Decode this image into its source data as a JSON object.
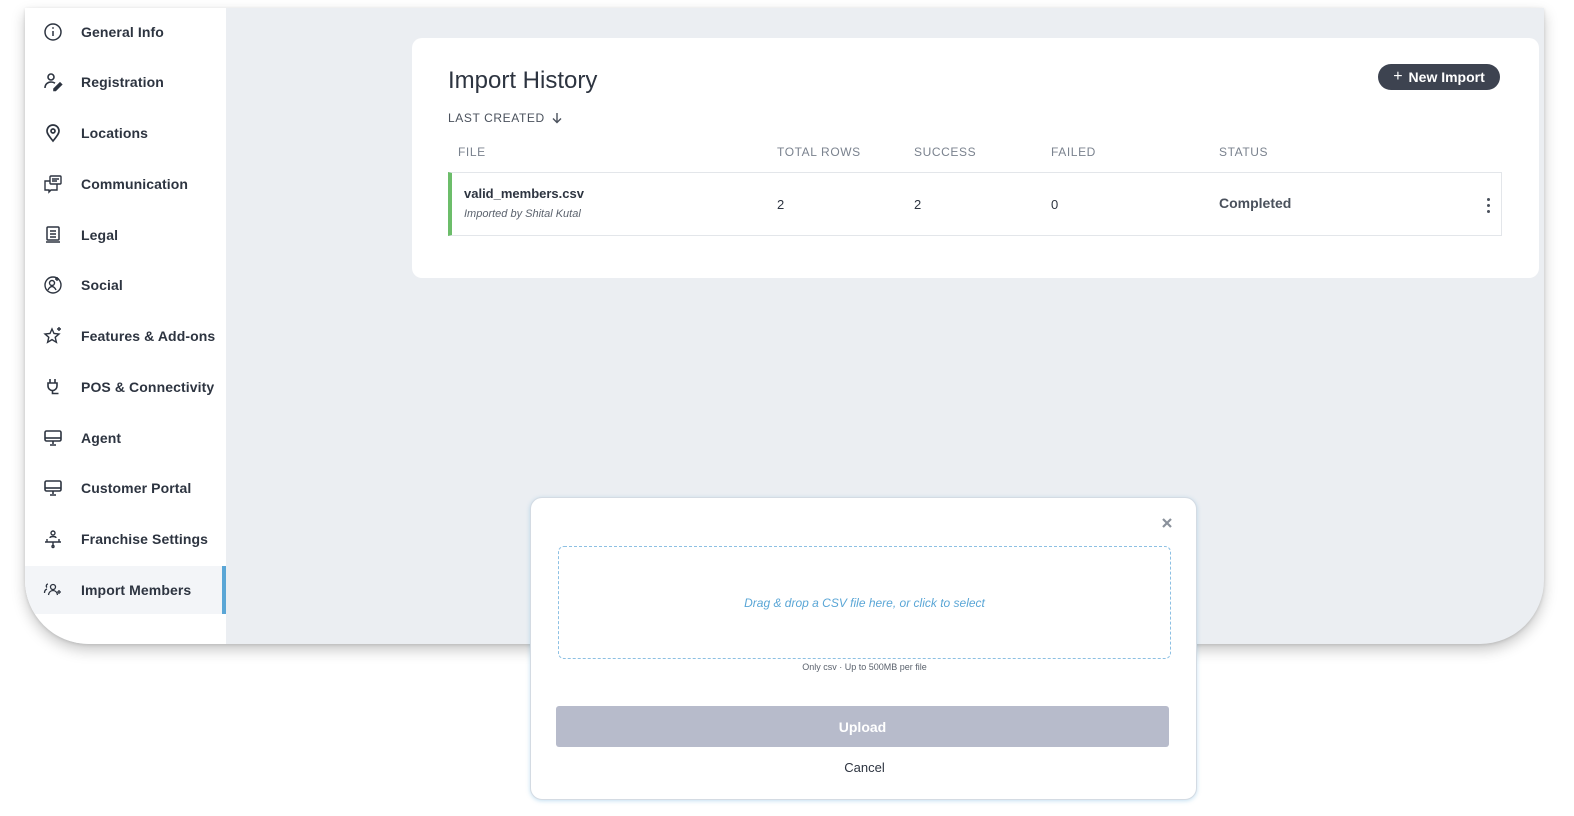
{
  "sidebar": {
    "items": [
      {
        "label": "General Info",
        "icon": "info-icon"
      },
      {
        "label": "Registration",
        "icon": "user-edit-icon"
      },
      {
        "label": "Locations",
        "icon": "location-pin-icon"
      },
      {
        "label": "Communication",
        "icon": "chat-window-icon"
      },
      {
        "label": "Legal",
        "icon": "document-icon"
      },
      {
        "label": "Social",
        "icon": "social-user-icon"
      },
      {
        "label": "Features & Add-ons",
        "icon": "star-plus-icon"
      },
      {
        "label": "POS & Connectivity",
        "icon": "plug-icon"
      },
      {
        "label": "Agent",
        "icon": "monitor-icon"
      },
      {
        "label": "Customer Portal",
        "icon": "monitor-icon"
      },
      {
        "label": "Franchise Settings",
        "icon": "franchise-icon"
      },
      {
        "label": "Import Members",
        "icon": "users-add-icon",
        "active": true
      }
    ]
  },
  "import_history": {
    "title": "Import History",
    "new_import_label": "New Import",
    "sort_label": "LAST CREATED",
    "columns": [
      "FILE",
      "TOTAL ROWS",
      "SUCCESS",
      "FAILED",
      "STATUS"
    ],
    "rows": [
      {
        "file": "valid_members.csv",
        "imported_by": "Imported by Shital Kutal",
        "total_rows": "2",
        "success": "2",
        "failed": "0",
        "status": "Completed",
        "status_color": "#6cbd6a"
      }
    ]
  },
  "upload_modal": {
    "dropzone_text": "Drag & drop a CSV file here, or click to select",
    "hint": "Only csv · Up to 500MB per file",
    "upload_label": "Upload",
    "cancel_label": "Cancel"
  },
  "colors": {
    "accent": "#5aa6d6",
    "dark_button": "#3d4350",
    "disabled_button": "#b7bbcb",
    "success": "#6cbd6a"
  }
}
